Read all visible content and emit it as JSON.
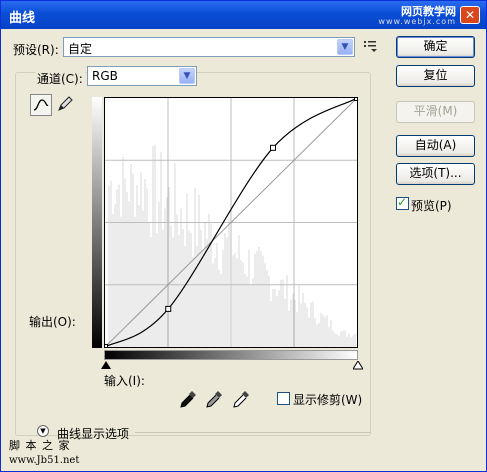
{
  "window": {
    "title": "曲线"
  },
  "watermark_top": {
    "line1": "网页教学网",
    "line2": "www.webjx.com"
  },
  "preset": {
    "label": "预设(R):",
    "value": "自定"
  },
  "channel": {
    "label": "通道(C):",
    "value": "RGB"
  },
  "output_label": "输出(O):",
  "input_label": "输入(I):",
  "buttons": {
    "ok": "确定",
    "reset": "复位",
    "smooth": "平滑(M)",
    "auto": "自动(A)",
    "options": "选项(T)..."
  },
  "preview": {
    "label": "预览(P)",
    "checked": true
  },
  "show_clipping": {
    "label": "显示修剪(W)",
    "checked": false
  },
  "curve_options_label": "曲线显示选项",
  "watermark_bottom": {
    "line1": "脚 本 之 家",
    "line2": "www.Jb51.net"
  },
  "curve": {
    "points": [
      [
        0,
        0
      ],
      [
        64,
        39
      ],
      [
        170,
        204
      ],
      [
        255,
        255
      ]
    ]
  },
  "icons": {
    "close": "close-icon",
    "menu": "preset-menu-icon",
    "curve_tool": "curve-point-tool-icon",
    "pencil_tool": "pencil-tool-icon",
    "black_eyedropper": "black-point-eyedropper-icon",
    "gray_eyedropper": "gray-point-eyedropper-icon",
    "white_eyedropper": "white-point-eyedropper-icon",
    "expand": "chevron-down-icon"
  }
}
